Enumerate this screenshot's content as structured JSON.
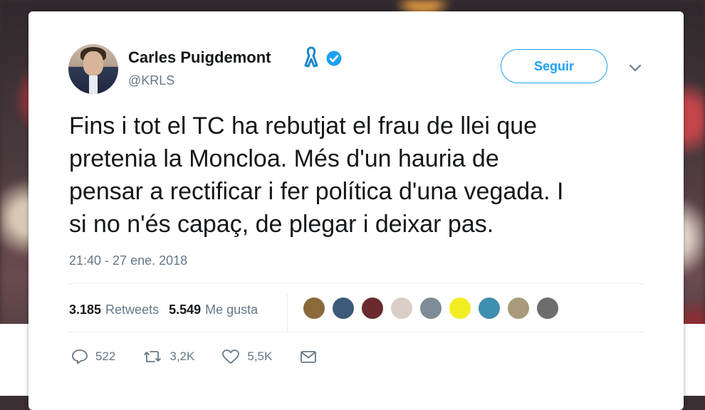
{
  "user": {
    "name": "Carles Puigdemont",
    "handle": "@KRLS"
  },
  "follow_label": "Seguir",
  "tweet": {
    "line1": "Fins i tot el TC ha rebutjat el frau de llei que",
    "line2": "pretenia la Moncloa. Més d'un hauria de",
    "line3": "pensar a rectificar i fer política d'una vegada. I",
    "line4": "si no n'és capaç, de plegar i deixar pas.",
    "timestamp": "21:40 - 27 ene. 2018"
  },
  "stats": {
    "retweets_count": "3.185",
    "retweets_label": "Retweets",
    "likes_count": "5.549",
    "likes_label": "Me gusta"
  },
  "liker_colors": [
    "#8a6a3a",
    "#3c5a7a",
    "#6a2a2e",
    "#d9cfc8",
    "#7d8c96",
    "#f2ee22",
    "#3f8fae",
    "#a89a7a",
    "#6d6d6d"
  ],
  "actions": {
    "replies": "522",
    "retweets": "3,2K",
    "likes": "5,5K"
  },
  "icons": {
    "ribbon": "yellow-ribbon-icon",
    "verified": "verified-badge-icon",
    "reply": "reply-icon",
    "retweet": "retweet-icon",
    "like": "heart-icon",
    "dm": "envelope-icon"
  },
  "colors": {
    "accent": "#1da1f2",
    "text": "#14171a",
    "muted": "#657786"
  }
}
